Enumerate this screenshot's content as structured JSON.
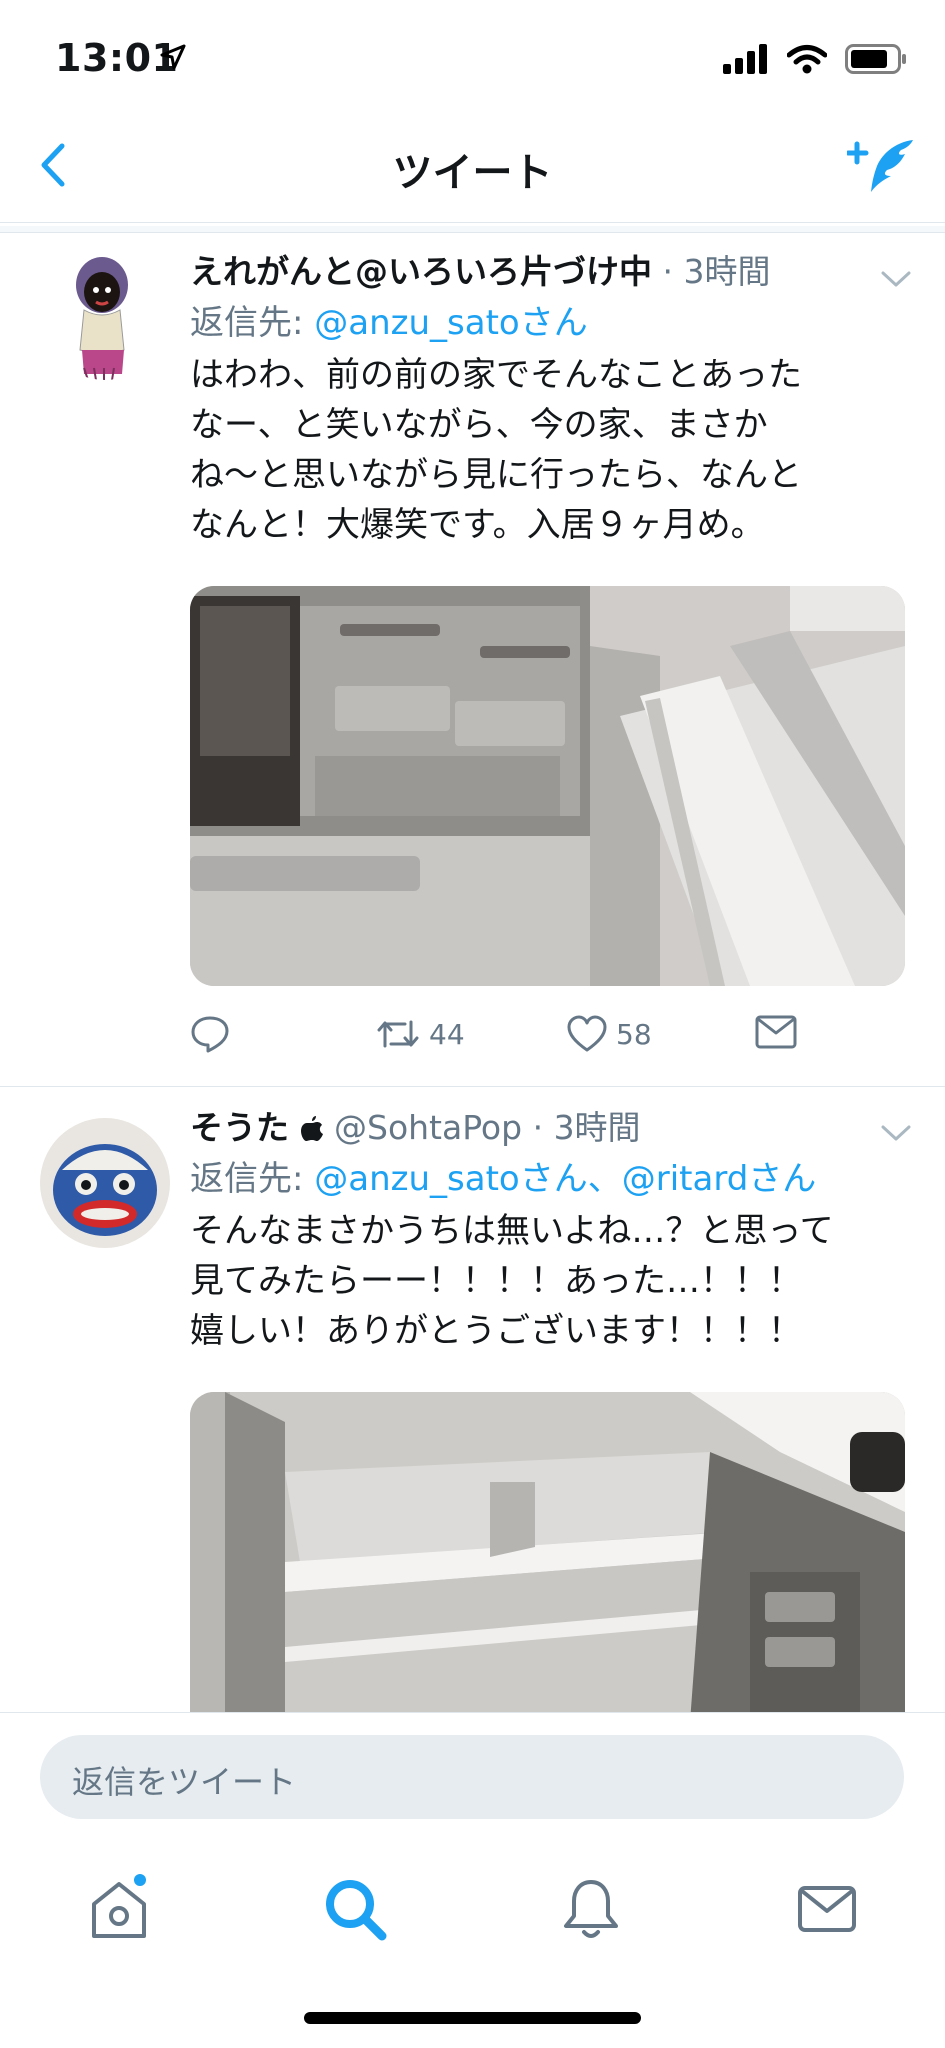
{
  "status_bar": {
    "time": "13:01"
  },
  "nav": {
    "title": "ツイート"
  },
  "tweets": [
    {
      "name": "えれがんと@いろいろ片づけ中",
      "time": "3時間",
      "reply_prefix": "返信先: ",
      "reply_to": "@anzu_satoさん",
      "text_lines": [
        "はわわ、前の前の家でそんなことあった",
        "なー、と笑いながら、今の家、まさか",
        "ね〜と思いながら見に行ったら、なんと",
        "なんと！大爆笑です。入居９ヶ月め。"
      ],
      "retweets": "44",
      "likes": "58"
    },
    {
      "name": "そうた",
      "handle": "@SohtaPop",
      "time": "3時間",
      "reply_prefix": "返信先: ",
      "reply_to": "@anzu_satoさん、@ritardさん",
      "text_lines": [
        "そんなまさかうちは無いよね…？と思って",
        "見てみたらーー！！！！あった…！！！",
        "嬉しい！ありがとうございます！！！！"
      ]
    }
  ],
  "reply_bar": {
    "placeholder": "返信をツイート"
  },
  "colors": {
    "accent": "#1da1f2",
    "secondary_text": "#657786"
  }
}
